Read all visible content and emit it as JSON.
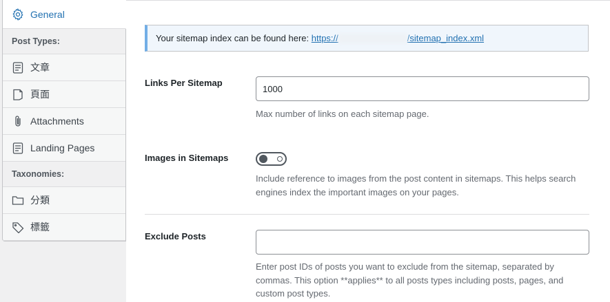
{
  "sidebar": {
    "general": {
      "label": "General",
      "icon": "gear-icon"
    },
    "post_types_heading": "Post Types:",
    "post_types": [
      {
        "label": "文章",
        "icon": "post-icon"
      },
      {
        "label": "頁面",
        "icon": "page-icon"
      },
      {
        "label": "Attachments",
        "icon": "paperclip-icon"
      },
      {
        "label": "Landing Pages",
        "icon": "landing-page-icon"
      }
    ],
    "taxonomies_heading": "Taxonomies:",
    "taxonomies": [
      {
        "label": "分類",
        "icon": "folder-icon"
      },
      {
        "label": "標籤",
        "icon": "tag-icon"
      }
    ]
  },
  "notice": {
    "text": "Your sitemap index can be found here: ",
    "link_prefix": "https://",
    "link_suffix": "/sitemap_index.xml"
  },
  "links_per_sitemap": {
    "label": "Links Per Sitemap",
    "value": "1000",
    "help": "Max number of links on each sitemap page."
  },
  "images_in_sitemaps": {
    "label": "Images in Sitemaps",
    "enabled": false,
    "help": "Include reference to images from the post content in sitemaps. This helps search engines index the important images on your pages."
  },
  "exclude_posts": {
    "label": "Exclude Posts",
    "value": "",
    "help": "Enter post IDs of posts you want to exclude from the sitemap, separated by commas. This option **applies** to all posts types including posts, pages, and custom post types."
  },
  "colors": {
    "accent": "#2271b1",
    "notice_border": "#72aee6",
    "notice_bg": "#f0f6fc"
  }
}
